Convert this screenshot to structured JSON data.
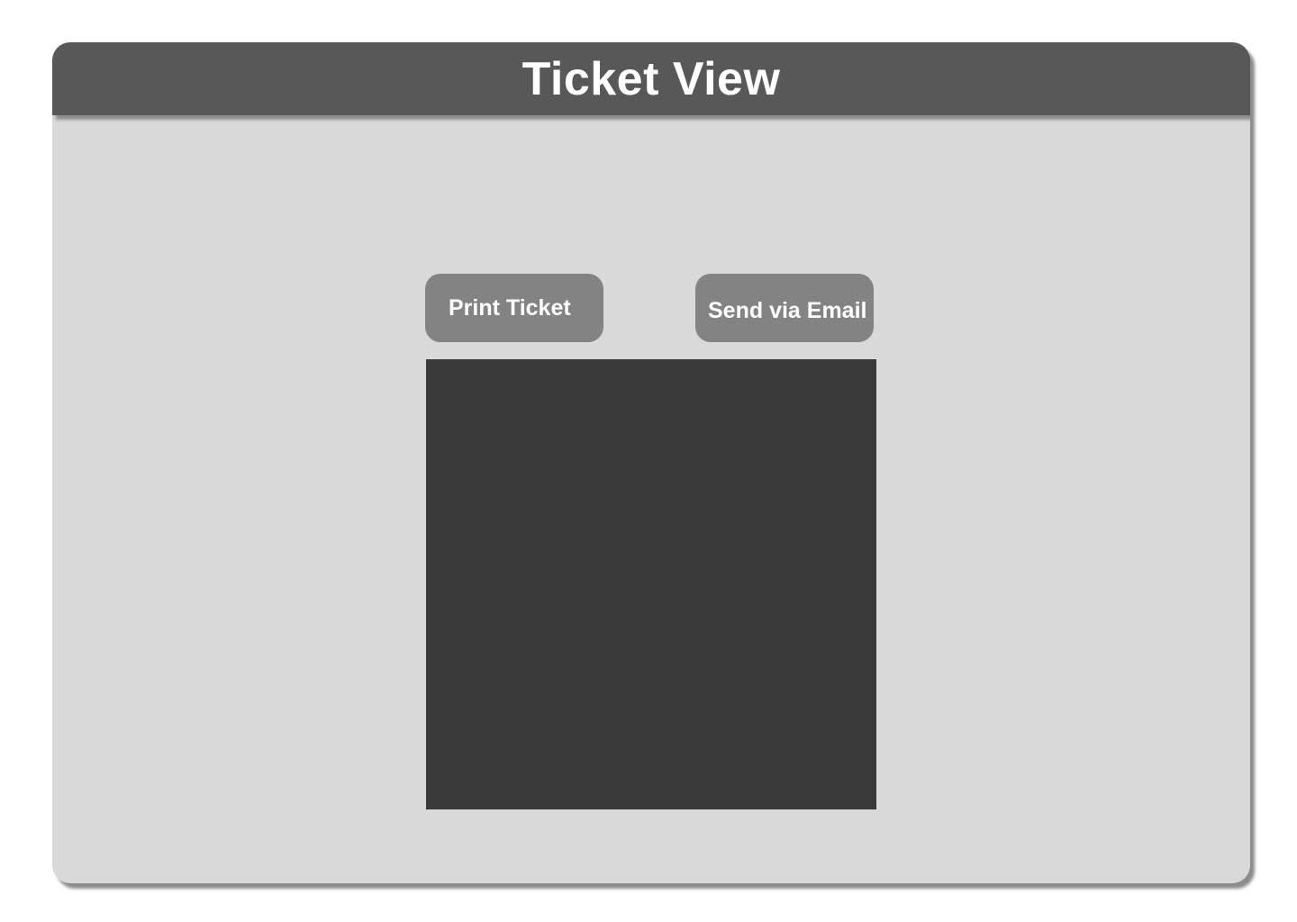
{
  "window": {
    "title": "Ticket View"
  },
  "actions": {
    "print_label": "Print Ticket",
    "email_label": "Send via Email"
  },
  "colors": {
    "title_bar": "#585858",
    "background": "#d9d9d9",
    "button": "#838383",
    "preview": "#3a3a3a"
  }
}
